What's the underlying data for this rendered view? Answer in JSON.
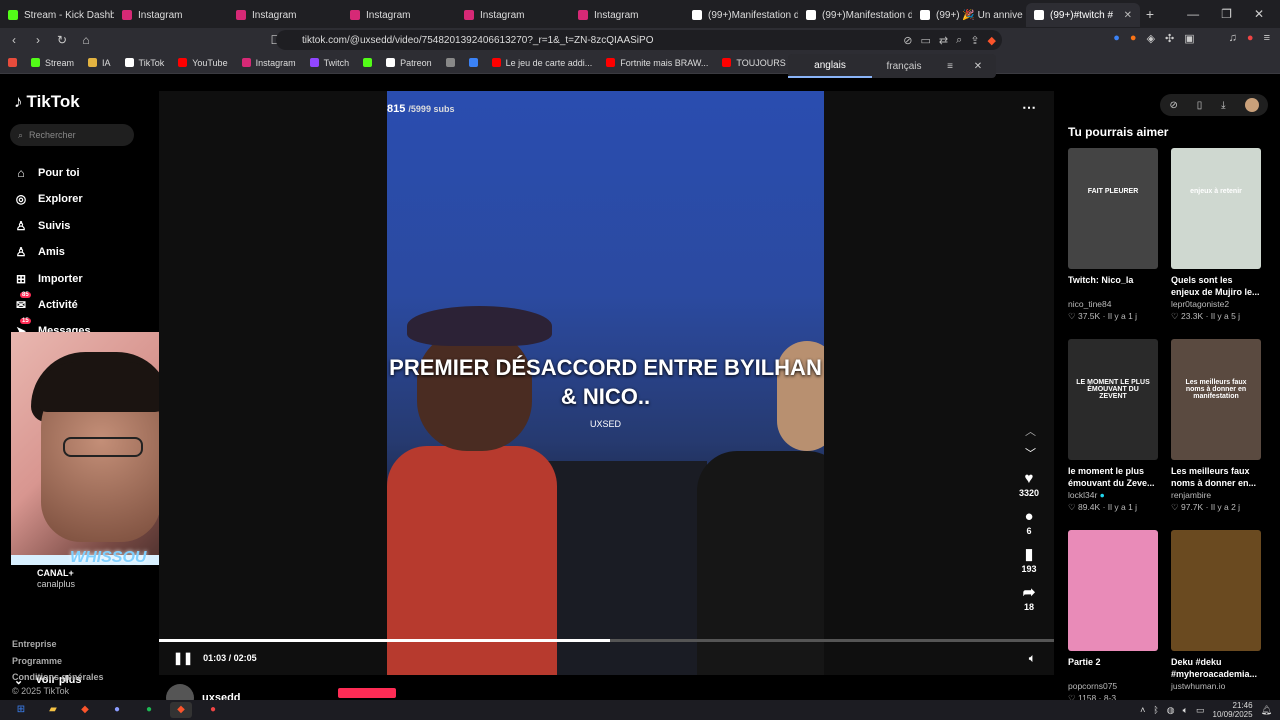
{
  "browser": {
    "tabs": [
      {
        "label": "Stream - Kick Dashboa",
        "color": "#53fc18",
        "active": false
      },
      {
        "label": "Instagram",
        "color": "#d62976",
        "active": false
      },
      {
        "label": "Instagram",
        "color": "#d62976",
        "active": false
      },
      {
        "label": "Instagram",
        "color": "#d62976",
        "active": false
      },
      {
        "label": "Instagram",
        "color": "#d62976",
        "active": false
      },
      {
        "label": "Instagram",
        "color": "#d62976",
        "active": false
      },
      {
        "label": "(99+)Manifestation du",
        "color": "#ffffff",
        "active": false
      },
      {
        "label": "(99+)Manifestation du",
        "color": "#ffffff",
        "active": false
      },
      {
        "label": "(99+) 🎉 Un annive",
        "color": "#ffffff",
        "active": false
      },
      {
        "label": "(99+)#twitch #",
        "color": "#ffffff",
        "active": true
      }
    ],
    "url": "tiktok.com/@uxsedd/video/7548201392406613270?_r=1&_t=ZN-8zcQIAASiPO",
    "bookmarks": [
      {
        "label": "Stream",
        "color": "#53fc18"
      },
      {
        "label": "IA",
        "color": "#e3b341"
      },
      {
        "label": "TikTok",
        "color": "#ffffff"
      },
      {
        "label": "YouTube",
        "color": "#ff0000"
      },
      {
        "label": "Instagram",
        "color": "#d62976"
      },
      {
        "label": "Twitch",
        "color": "#9146ff"
      },
      {
        "label": "",
        "color": "#53fc18"
      },
      {
        "label": "Patreon",
        "color": "#ffffff"
      },
      {
        "label": "",
        "color": "#888888"
      },
      {
        "label": "",
        "color": "#3b82f6"
      },
      {
        "label": "Le jeu de carte addi...",
        "color": "#ff0000"
      },
      {
        "label": "Fortnite mais BRAW...",
        "color": "#ff0000"
      },
      {
        "label": "TOUJOURS gagner...",
        "color": "#ff0000"
      }
    ],
    "translate": {
      "from": "anglais",
      "to": "français"
    }
  },
  "sidebar": {
    "logo": "TikTok",
    "search_placeholder": "Rechercher",
    "nav": [
      {
        "label": "Pour toi",
        "icon": "home-icon",
        "glyph": "⌂"
      },
      {
        "label": "Explorer",
        "icon": "compass-icon",
        "glyph": "◎"
      },
      {
        "label": "Suivis",
        "icon": "following-icon",
        "glyph": "♙"
      },
      {
        "label": "Amis",
        "icon": "friends-icon",
        "glyph": "♙"
      },
      {
        "label": "Importer",
        "icon": "upload-icon",
        "glyph": "⊞"
      },
      {
        "label": "Activité",
        "icon": "activity-icon",
        "glyph": "✉",
        "badge": "85"
      },
      {
        "label": "Messages",
        "icon": "messages-icon",
        "glyph": "➤",
        "badge": "15"
      }
    ],
    "overlay_name": "WHISSOU",
    "account_name": "CANAL+",
    "account_handle": "canalplus",
    "voir_plus": "Voir plus",
    "footer": [
      "Entreprise",
      "Programme",
      "Conditions générales",
      "© 2025 TikTok"
    ]
  },
  "video": {
    "sub_count": "815",
    "sub_goal": "/5999 subs",
    "caption": "PREMIER DÉSACCORD ENTRE BYILHAN & NICO..",
    "watermark": "UXSED",
    "current_time": "01:03",
    "total_time": "02:05",
    "progress": 0.504,
    "likes": "3320",
    "comments": "6",
    "saves": "193",
    "shares": "18",
    "author": "uxsedd"
  },
  "recommendations": {
    "title": "Tu pourrais aimer",
    "items": [
      {
        "title": "Twitch: Nico_la",
        "user": "nico_tine84",
        "likes": "37.5K",
        "age": "Il y a 1 j",
        "thumb": "#444",
        "thumb_text": "FAIT PLEURER",
        "verified": false
      },
      {
        "title": "Quels sont les enjeux de Mujiro le...",
        "user": "lepr0tagoniste2",
        "likes": "23.3K",
        "age": "Il y a 5 j",
        "thumb": "#cfd8d0",
        "thumb_text": "enjeux à retenir",
        "verified": false
      },
      {
        "title": "le moment le plus émouvant du Zeve...",
        "user": "lockl34r",
        "likes": "89.4K",
        "age": "Il y a 1 j",
        "thumb": "#2a2a2a",
        "thumb_text": "LE MOMENT LE PLUS ÉMOUVANT DU ZEVENT",
        "verified": true
      },
      {
        "title": "Les meilleurs faux noms à donner en...",
        "user": "renjambire",
        "likes": "97.7K",
        "age": "Il y a 2 j",
        "thumb": "#5a4a40",
        "thumb_text": "Les meilleurs faux noms à donner en manifestation",
        "verified": false
      },
      {
        "title": "Partie 2",
        "user": "popcorns075",
        "likes": "1158",
        "age": "8-3",
        "thumb": "#e98bb8",
        "thumb_text": "",
        "verified": false
      },
      {
        "title": "Deku #deku #myheroacademia...",
        "user": "justwhuman.io",
        "likes": "",
        "age": "",
        "thumb": "#6a4a20",
        "thumb_text": "",
        "verified": false
      }
    ]
  },
  "taskbar": {
    "time": "21:46",
    "date": "10/09/2025"
  }
}
